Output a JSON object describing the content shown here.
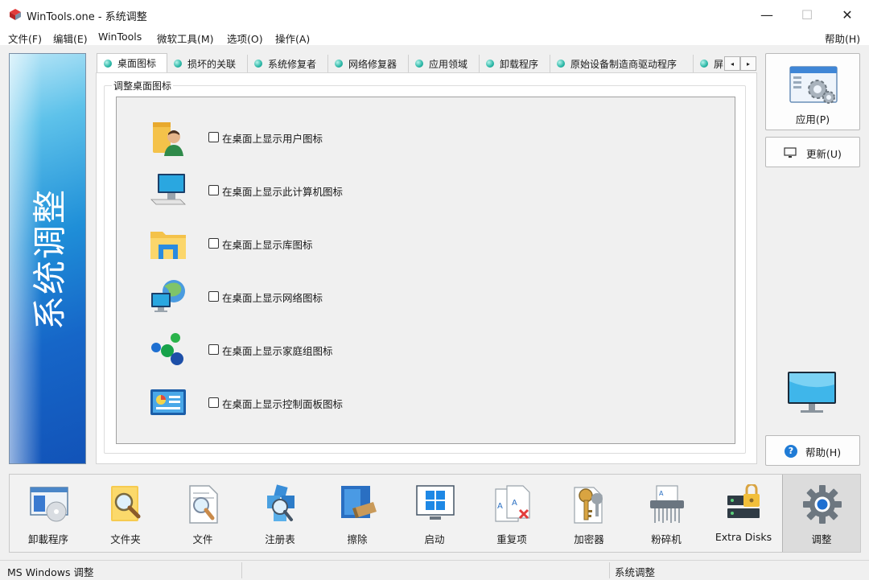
{
  "window": {
    "title": "WinTools.one - 系统调整",
    "minimize_glyph": "—",
    "maximize_glyph": "☐",
    "close_glyph": "✕"
  },
  "menu": {
    "items": [
      "文件(F)",
      "编辑(E)",
      "WinTools",
      "微软工具(M)",
      "选项(O)",
      "操作(A)"
    ],
    "help": "帮助(H)"
  },
  "banner": {
    "text": "系统调整"
  },
  "tabs": {
    "items": [
      "桌面图标",
      "损坏的关联",
      "系统修复者",
      "网络修复器",
      "应用领域",
      "卸载程序",
      "原始设备制造商驱动程序",
      "屏"
    ],
    "active_index": 0,
    "scroll_left": "◂",
    "scroll_right": "▸"
  },
  "group": {
    "title": "调整桌面图标",
    "options": [
      {
        "label": "在桌面上显示用户图标",
        "icon": "user-folder-icon",
        "checked": false
      },
      {
        "label": "在桌面上显示此计算机图标",
        "icon": "computer-icon",
        "checked": false
      },
      {
        "label": "在桌面上显示库图标",
        "icon": "library-folder-icon",
        "checked": false
      },
      {
        "label": "在桌面上显示网络图标",
        "icon": "network-icon",
        "checked": false
      },
      {
        "label": "在桌面上显示家庭组图标",
        "icon": "homegroup-icon",
        "checked": false
      },
      {
        "label": "在桌面上显示控制面板图标",
        "icon": "control-panel-icon",
        "checked": false
      }
    ]
  },
  "side": {
    "apply": "应用(P)",
    "refresh": "更新(U)",
    "help": "帮助(H)",
    "help_glyph": "?"
  },
  "toolbar": {
    "items": [
      "卸載程序",
      "文件夹",
      "文件",
      "注册表",
      "擦除",
      "启动",
      "重复项",
      "加密器",
      "粉碎机",
      "Extra Disks",
      "调整"
    ],
    "active_index": 10
  },
  "status": {
    "left": "MS Windows 调整",
    "right": "系统调整"
  },
  "colors": {
    "accent": "#1f7bd6",
    "banner_top": "#5ec2ea",
    "banner_bottom": "#1253b8",
    "tab_dot": "#2ab7a6"
  }
}
